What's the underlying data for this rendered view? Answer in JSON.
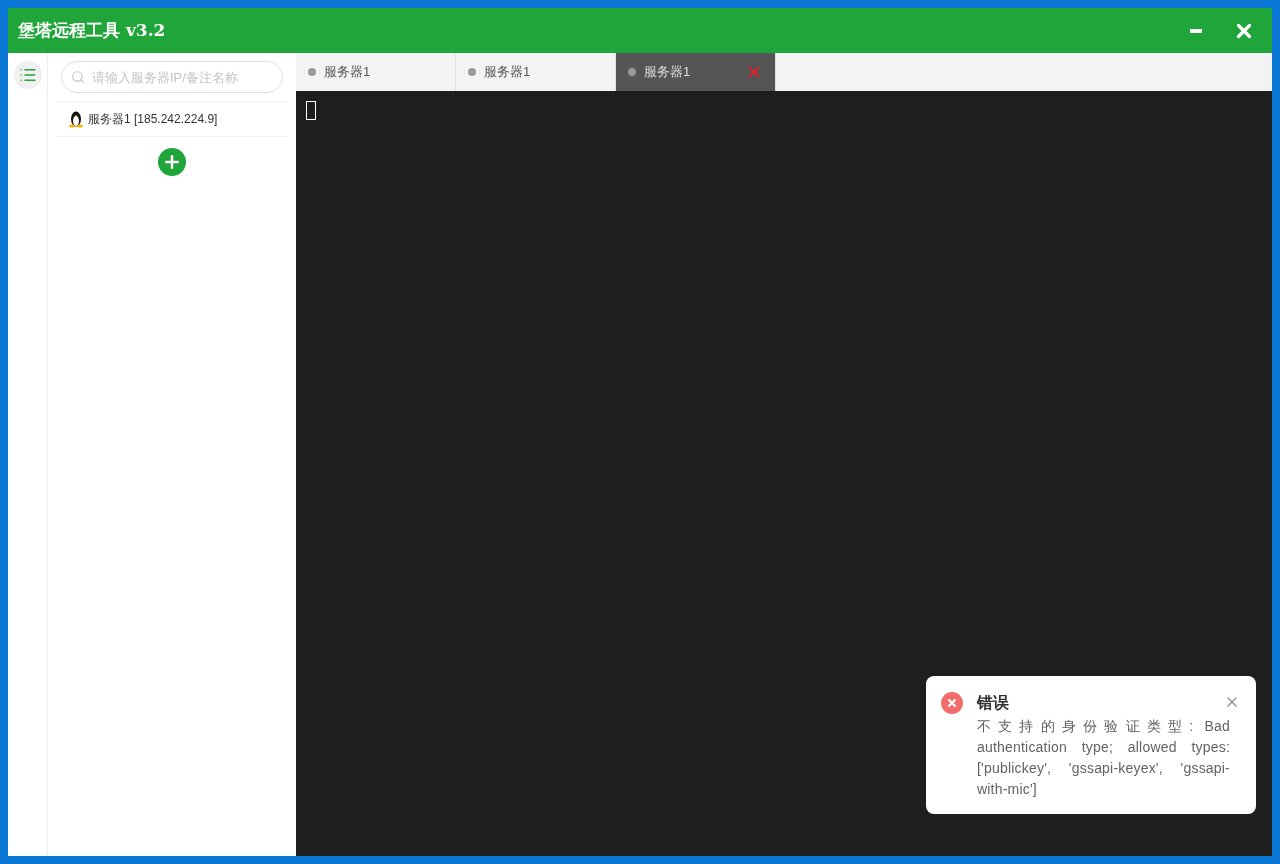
{
  "window": {
    "title": "堡塔远程工具 v3.2"
  },
  "search": {
    "placeholder": "请输入服务器IP/备注名称"
  },
  "servers": [
    {
      "label": "服务器1 [185.242.224.9]"
    }
  ],
  "tabs": [
    {
      "label": "服务器1",
      "selected": false
    },
    {
      "label": "服务器1",
      "selected": false
    },
    {
      "label": "服务器1",
      "selected": true
    }
  ],
  "terminal": {
    "cursor": true
  },
  "notification": {
    "title": "错误",
    "message": "不支持的身份验证类型: Bad authentication type; allowed types: ['publickey', 'gssapi-keyex', 'gssapi-with-mic']"
  }
}
